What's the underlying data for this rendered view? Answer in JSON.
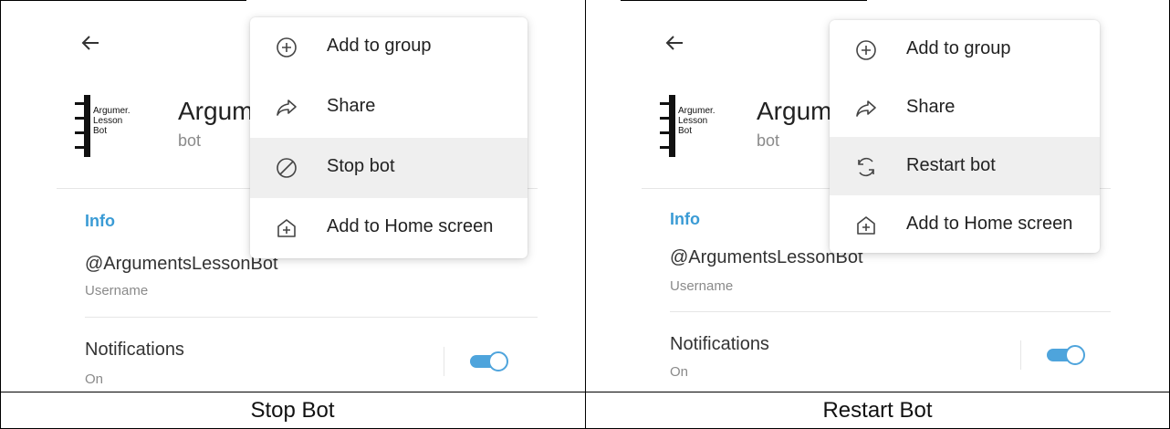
{
  "panels": [
    {
      "profile": {
        "avatar_text": [
          "Argumer.",
          "Lesson",
          "Bot"
        ],
        "name": "Argum",
        "subtitle": "bot"
      },
      "info": {
        "section_label": "Info",
        "username_value": "@ArgumentsLessonBot",
        "username_label": "Username"
      },
      "notifications": {
        "label": "Notifications",
        "state": "On",
        "toggle_on": true
      },
      "menu": [
        {
          "label": "Add to group",
          "icon": "plus-circle-icon",
          "highlighted": false
        },
        {
          "label": "Share",
          "icon": "share-arrow-icon",
          "highlighted": false
        },
        {
          "label": "Stop bot",
          "icon": "block-icon",
          "highlighted": true
        },
        {
          "label": "Add to Home screen",
          "icon": "add-home-icon",
          "highlighted": false
        }
      ],
      "caption": "Stop Bot"
    },
    {
      "profile": {
        "avatar_text": [
          "Argumer.",
          "Lesson",
          "Bot"
        ],
        "name": "Argum",
        "subtitle": "bot"
      },
      "info": {
        "section_label": "Info",
        "username_value": "@ArgumentsLessonBot",
        "username_label": "Username"
      },
      "notifications": {
        "label": "Notifications",
        "state": "On",
        "toggle_on": true
      },
      "menu": [
        {
          "label": "Add to group",
          "icon": "plus-circle-icon",
          "highlighted": false
        },
        {
          "label": "Share",
          "icon": "share-arrow-icon",
          "highlighted": false
        },
        {
          "label": "Restart bot",
          "icon": "restart-icon",
          "highlighted": true
        },
        {
          "label": "Add to Home screen",
          "icon": "add-home-icon",
          "highlighted": false
        }
      ],
      "caption": "Restart Bot"
    }
  ],
  "colors": {
    "accent": "#3a9bd5",
    "toggle": "#4ea4dc",
    "highlight": "#efefef"
  }
}
